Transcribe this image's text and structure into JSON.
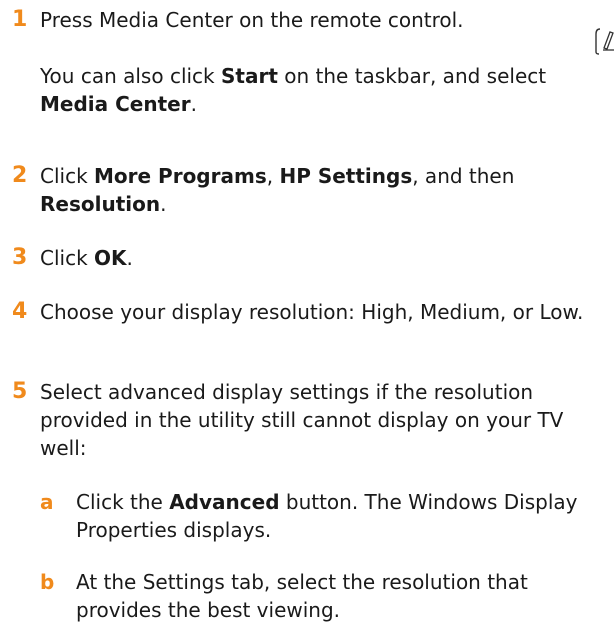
{
  "steps": [
    {
      "number": "1",
      "text": "Press Media Center on the remote control.",
      "note": {
        "pre": "You can also click ",
        "b1": "Start",
        "mid": " on the taskbar, and select ",
        "b2": "Media Center",
        "post": "."
      }
    },
    {
      "number": "2",
      "pre": "Click ",
      "b1": "More Programs",
      "sep1": ", ",
      "b2": "HP Settings",
      "sep2": ", and then ",
      "b3": "Resolution",
      "post": "."
    },
    {
      "number": "3",
      "pre": "Click ",
      "b1": "OK",
      "post": "."
    },
    {
      "number": "4",
      "text": "Choose your display resolution: High, Medium, or Low."
    },
    {
      "number": "5",
      "text": "Select advanced display settings if the resolution provided in the utility still cannot display on your TV well:",
      "substeps": [
        {
          "letter": "a",
          "pre": "Click the ",
          "b1": "Advanced",
          "post": " button. The Windows Display Properties displays."
        },
        {
          "letter": "b",
          "text": "At the Settings tab, select the resolution that provides the best viewing."
        }
      ]
    }
  ],
  "colors": {
    "accent": "#f08a1c",
    "text": "#1a1a1a"
  },
  "icons": {
    "margin": "note-pencil-icon"
  }
}
